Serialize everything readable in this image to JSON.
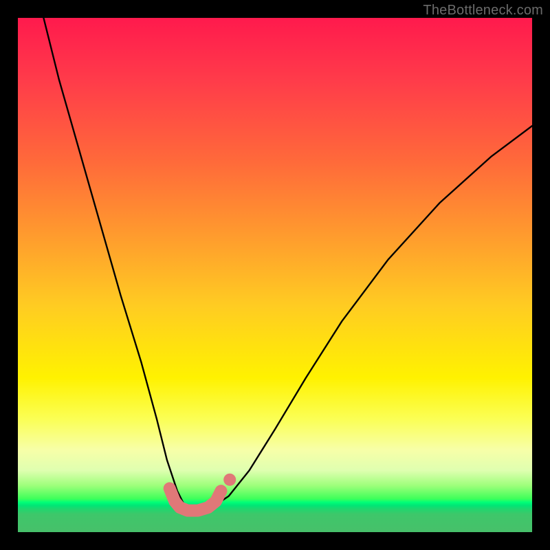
{
  "watermark": "TheBottleneck.com",
  "chart_data": {
    "type": "line",
    "title": "",
    "xlabel": "",
    "ylabel": "",
    "xlim": [
      0,
      100
    ],
    "ylim": [
      0,
      100
    ],
    "grid": false,
    "legend": false,
    "series": [
      {
        "name": "bottleneck-curve",
        "x": [
          5,
          8,
          12,
          16,
          20,
          24,
          27,
          29,
          31,
          32.5,
          34,
          36,
          38,
          41,
          45,
          50,
          56,
          63,
          72,
          82,
          92,
          100
        ],
        "y": [
          100,
          88,
          74,
          60,
          46,
          33,
          22,
          14,
          8,
          5,
          4,
          4,
          5,
          7,
          12,
          20,
          30,
          41,
          53,
          64,
          73,
          79
        ],
        "color": "#000000",
        "width": 2.4
      },
      {
        "name": "optimal-band",
        "x": [
          29.5,
          30.5,
          31.5,
          33,
          35,
          37,
          38.5,
          39.5
        ],
        "y": [
          8.5,
          6.0,
          4.8,
          4.2,
          4.2,
          4.8,
          6.0,
          8.0
        ],
        "color": "#e07878",
        "width": 18
      },
      {
        "name": "optimal-end-marker",
        "x": [
          41.2
        ],
        "y": [
          10.2
        ],
        "color": "#e07878",
        "marker": "circle",
        "size": 9
      }
    ]
  }
}
